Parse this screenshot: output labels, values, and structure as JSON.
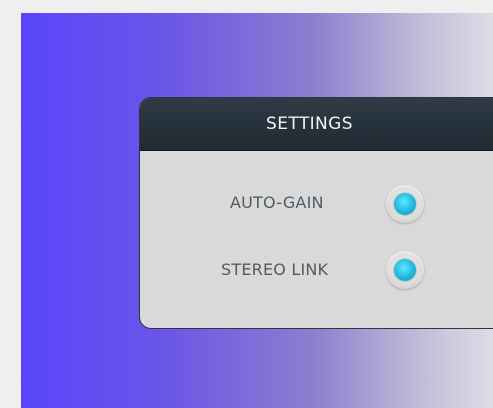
{
  "panel": {
    "title": "SETTINGS",
    "options": [
      {
        "label": "AUTO-GAIN",
        "enabled": true
      },
      {
        "label": "STEREO LINK",
        "enabled": true
      }
    ]
  },
  "colors": {
    "background_start": "#5a46fb",
    "background_end": "#dedce6",
    "header_dark": "#1f2a33",
    "indicator_on": "#1fb9de"
  }
}
